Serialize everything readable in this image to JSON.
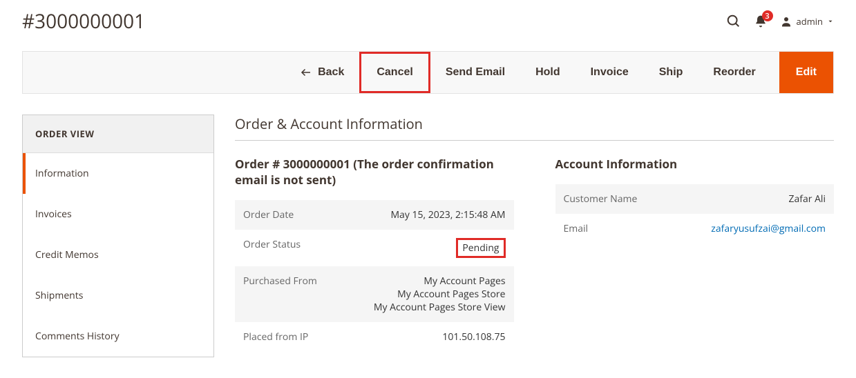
{
  "header": {
    "title": "#3000000001",
    "notificationCount": "3",
    "adminLabel": "admin"
  },
  "actions": {
    "back": "Back",
    "cancel": "Cancel",
    "sendEmail": "Send Email",
    "hold": "Hold",
    "invoice": "Invoice",
    "ship": "Ship",
    "reorder": "Reorder",
    "edit": "Edit"
  },
  "sidebar": {
    "heading": "ORDER VIEW",
    "items": {
      "information": "Information",
      "invoices": "Invoices",
      "creditMemos": "Credit Memos",
      "shipments": "Shipments",
      "commentsHistory": "Comments History"
    }
  },
  "main": {
    "sectionTitle": "Order & Account Information",
    "orderHeading": "Order # 3000000001 (The order confirmation email is not sent)",
    "orderInfo": {
      "orderDateLabel": "Order Date",
      "orderDateValue": "May 15, 2023, 2:15:48 AM",
      "orderStatusLabel": "Order Status",
      "orderStatusValue": "Pending",
      "purchasedFromLabel": "Purchased From",
      "purchasedFromLine1": "My Account Pages",
      "purchasedFromLine2": "My Account Pages Store",
      "purchasedFromLine3": "My Account Pages Store View",
      "placedFromIpLabel": "Placed from IP",
      "placedFromIpValue": "101.50.108.75"
    },
    "accountHeading": "Account Information",
    "accountInfo": {
      "customerNameLabel": "Customer Name",
      "customerNameValue": "Zafar Ali",
      "emailLabel": "Email",
      "emailValue": "zafaryusufzai@gmail.com"
    }
  }
}
